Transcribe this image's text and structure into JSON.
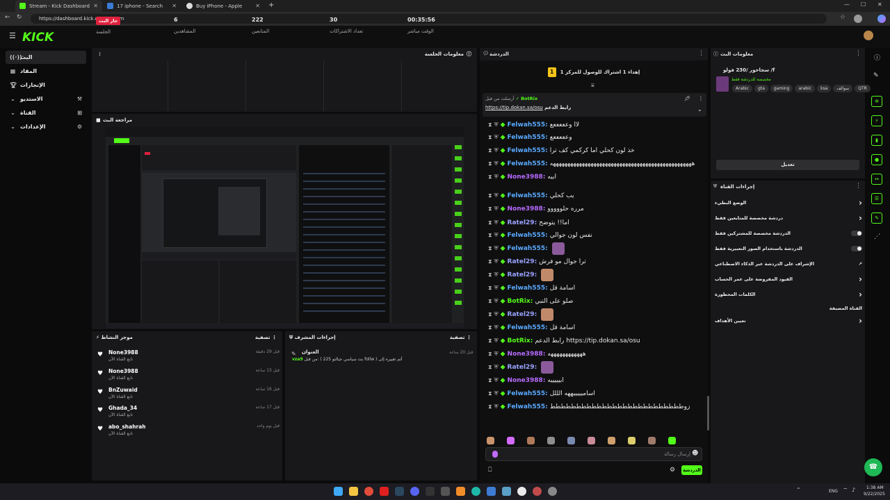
{
  "browser": {
    "tabs": [
      {
        "title": "Stream - Kick Dashboard",
        "active": true
      },
      {
        "title": "17 iphone - Search",
        "active": false
      },
      {
        "title": "Buy iPhone - Apple",
        "active": false
      }
    ],
    "url": "https://dashboard.kick.com/stream"
  },
  "kick": {
    "logo": "KICK"
  },
  "sidebar": {
    "items": [
      {
        "label": "البث",
        "icon": "live-icon"
      },
      {
        "label": "المقاد",
        "icon": "grid-icon"
      },
      {
        "label": "الإنجازات",
        "icon": "trophy-icon"
      },
      {
        "label": "الاستديو",
        "icon": "studio-icon"
      },
      {
        "label": "القناة",
        "icon": "channel-icon"
      },
      {
        "label": "الإعدادات",
        "icon": "settings-icon"
      }
    ]
  },
  "session": {
    "title": "معلومات الجلسة",
    "stats": [
      {
        "value": "جار البث",
        "label": "الجلسة"
      },
      {
        "value": "6",
        "label": "المشاهدين"
      },
      {
        "value": "222",
        "label": "المتابعين"
      },
      {
        "value": "30",
        "label": "تعداد الاشتراكات"
      },
      {
        "value": "00:35:56",
        "label": "الوقت مباشر"
      }
    ]
  },
  "preview": {
    "title": "مراجعة البث"
  },
  "activity": {
    "title": "موجز النشاط",
    "filter": "تصفية",
    "items": [
      {
        "name": "None3988",
        "action": "تابع القناة الآن",
        "time": "قبل 29 دقيقة"
      },
      {
        "name": "None3988",
        "action": "تابع القناة الآن",
        "time": "قبل 13 ساعة"
      },
      {
        "name": "BnZuwaid",
        "action": "تابع القناة الآن",
        "time": "قبل 16 ساعة"
      },
      {
        "name": "Ghada_34",
        "action": "تابع القناة الآن",
        "time": "قبل 17 ساعة"
      },
      {
        "name": "abo_shahrah",
        "action": "تابع القناة الآن",
        "time": "قبل يوم واحد"
      }
    ]
  },
  "modactions": {
    "title": "إجراءات المشرف",
    "filter": "تصفية",
    "item_title": "العنوان",
    "item_user": "vza9",
    "item_text": "من قبل: ( بث سياسي جيالنو 225 follw ) أتم تغييره إلى",
    "item_time": "قبل 20 ساعة"
  },
  "chat": {
    "title": "الدردشة",
    "pinned_goal": "إهداء 1 اشتراك للوصول للمركز 1",
    "pinned_by": "أرسلت من قبل",
    "pinned_user": "BotRix",
    "pinned_label": "رابط الدعم",
    "pinned_link": "https://tip.dokan.sa/osu",
    "messages": [
      {
        "user": "Felwah555:",
        "color": "#5aa9ff",
        "text": "لاا وعععععع"
      },
      {
        "user": "Felwah555:",
        "color": "#5aa9ff",
        "text": "وعععععع"
      },
      {
        "user": "Felwah555:",
        "color": "#5aa9ff",
        "text": "خذ لون كحلي اما كركمي كف ترا"
      },
      {
        "user": "Felwah555:",
        "color": "#5aa9ff",
        "text": "هههههههههههههههههههههههههههههههههههههههههههههههههه"
      },
      {
        "user": "None3988:",
        "color": "#b76bff",
        "text": "ابيه"
      },
      {
        "user": "Felwah555:",
        "color": "#5aa9ff",
        "text": "يب كحلي"
      },
      {
        "user": "None3988:",
        "color": "#b76bff",
        "text": "مرره حلووووو"
      },
      {
        "user": "Ratel29:",
        "color": "#9aa3ff",
        "text": "اما!! يتوضح"
      },
      {
        "user": "Felwah555:",
        "color": "#5aa9ff",
        "text": "نفس لون جوالي"
      },
      {
        "user": "Felwah555:",
        "color": "#5aa9ff",
        "text": ""
      },
      {
        "user": "Ratel29:",
        "color": "#9aa3ff",
        "text": "ترا جوال مو فرش"
      },
      {
        "user": "Ratel29:",
        "color": "#9aa3ff",
        "text": ""
      },
      {
        "user": "Felwah555:",
        "color": "#5aa9ff",
        "text": "اسامة قل"
      },
      {
        "user": "BotRix:",
        "color": "#53fc18",
        "text": "صلو على النبي"
      },
      {
        "user": "Ratel29:",
        "color": "#9aa3ff",
        "text": ""
      },
      {
        "user": "Felwah555:",
        "color": "#5aa9ff",
        "text": "اسامة قل"
      },
      {
        "user": "BotRix:",
        "color": "#53fc18",
        "text": "رابط الدعم https://tip.dokan.sa/osu"
      },
      {
        "user": "None3988:",
        "color": "#b76bff",
        "text": "ههههههههههههه"
      },
      {
        "user": "Ratel29:",
        "color": "#9aa3ff",
        "text": ""
      },
      {
        "user": "None3988:",
        "color": "#b76bff",
        "text": "ابيييييه"
      },
      {
        "user": "Felwah555:",
        "color": "#5aa9ff",
        "text": "اساميييييههه الللل"
      },
      {
        "user": "Felwah555:",
        "color": "#5aa9ff",
        "text": "زوطططططططططططططططططططططططططط"
      }
    ],
    "input_placeholder": "إرسال رسالة",
    "send_label": "الدردشة"
  },
  "streaminfo": {
    "title": "معلومات البث",
    "stream_title": "سجاحور /230 فولو /f",
    "subtitle": "مخصصة للدردشة فقط",
    "tags": [
      "Arabic",
      "gta",
      "gaming",
      "arabic",
      "ksa",
      "سوالف",
      "QTR"
    ],
    "edit_label": "تعديل"
  },
  "channelactions": {
    "title": "إجراءات القناة",
    "rows": [
      {
        "label": "الوضع البطيء",
        "kind": "chevron"
      },
      {
        "label": "دردشة مخصصة للمتابعين فقط",
        "kind": "chevron"
      },
      {
        "label": "الدردشة مخصصة للمشتركين فقط",
        "kind": "toggle"
      },
      {
        "label": "الدردشة باستخدام الصور التعبيرية فقط",
        "kind": "toggle"
      },
      {
        "label": "الإشراف على الدردشة عبر الذكاء الاصطناعي",
        "kind": "external"
      },
      {
        "label": "القيود المفروضة على عمر الحساب",
        "kind": "chevron"
      },
      {
        "label": "الكلمات المحظورة",
        "kind": "chevron"
      },
      {
        "label": "القناة المضيفة",
        "kind": "none"
      },
      {
        "label": "تعيين الأهداف",
        "kind": "chevron"
      }
    ]
  },
  "taskbar": {
    "lang": "ENG",
    "time": "1:38 AM",
    "date": "9/22/2025"
  }
}
